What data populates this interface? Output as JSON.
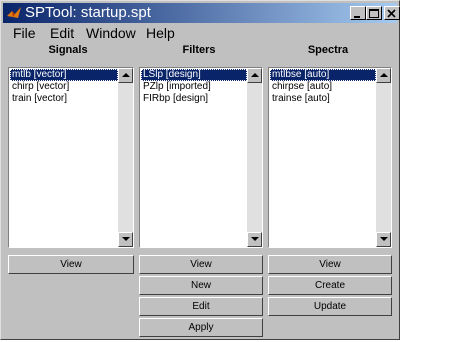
{
  "window": {
    "title": "SPTool: startup.spt"
  },
  "menu": [
    "File",
    "Edit",
    "Window",
    "Help"
  ],
  "columns": {
    "signals": {
      "label": "Signals",
      "items": [
        "mtlb [vector]",
        "chirp [vector]",
        "train [vector]"
      ],
      "selected_index": 0,
      "buttons": [
        "View"
      ]
    },
    "filters": {
      "label": "Filters",
      "items": [
        "LSlp [design]",
        "PZlp [imported]",
        "FIRbp [design]"
      ],
      "selected_index": 0,
      "buttons": [
        "View",
        "New",
        "Edit",
        "Apply"
      ]
    },
    "spectra": {
      "label": "Spectra",
      "items": [
        "mtlbse [auto]",
        "chirpse [auto]",
        "trainse [auto]"
      ],
      "selected_index": 0,
      "buttons": [
        "View",
        "Create",
        "Update"
      ]
    }
  },
  "icons": [
    "matlab-logo-icon",
    "minimize-icon",
    "maximize-icon",
    "close-icon",
    "scroll-up-icon",
    "scroll-down-icon"
  ]
}
